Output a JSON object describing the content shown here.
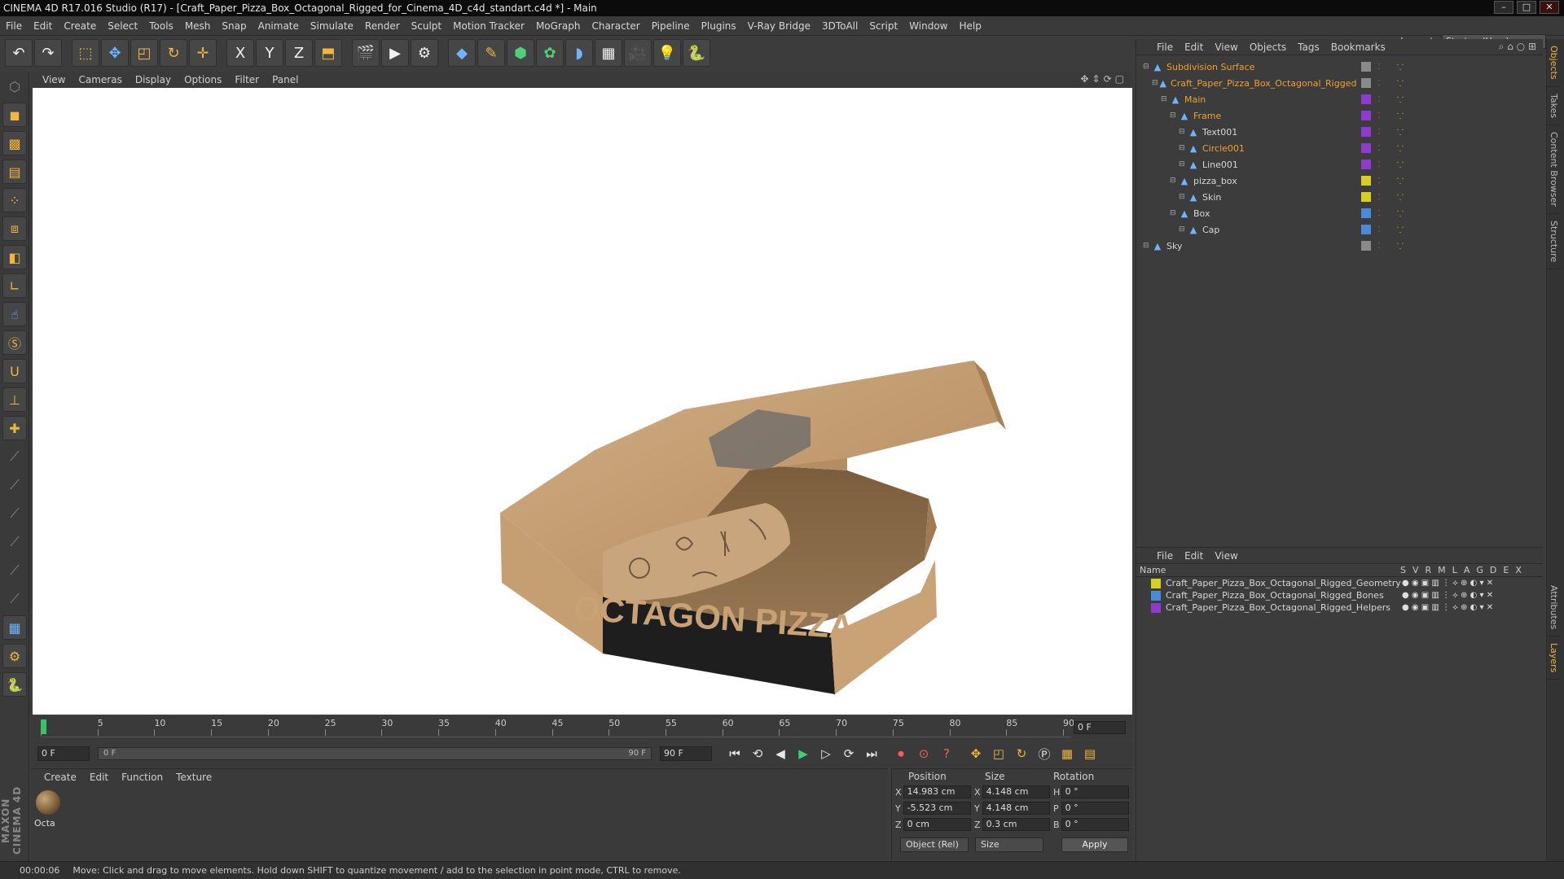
{
  "window": {
    "title": "CINEMA 4D R17.016 Studio (R17) - [Craft_Paper_Pizza_Box_Octagonal_Rigged_for_Cinema_4D_c4d_standart.c4d *] - Main"
  },
  "menubar": {
    "items": [
      "File",
      "Edit",
      "Create",
      "Select",
      "Tools",
      "Mesh",
      "Snap",
      "Animate",
      "Simulate",
      "Render",
      "Sculpt",
      "Motion Tracker",
      "MoGraph",
      "Character",
      "Pipeline",
      "Plugins",
      "V-Ray Bridge",
      "3DToAll",
      "Script",
      "Window",
      "Help"
    ],
    "layout_label": "Layout:",
    "layout_value": "Startup (User)"
  },
  "toolbar": {
    "icons": [
      "undo-icon",
      "redo-icon",
      "live-select-icon",
      "move-icon",
      "scale-icon",
      "rotate-icon",
      "add-icon",
      "x-axis-icon",
      "y-axis-icon",
      "z-axis-icon",
      "coordinate-system-icon",
      "render-view-icon",
      "render-picture-viewer-icon",
      "edit-render-settings-icon",
      "cube-icon",
      "pen-icon",
      "subdivision-icon",
      "array-icon",
      "deformer-icon",
      "floor-icon",
      "camera-icon",
      "light-icon",
      "python-icon"
    ],
    "axis_labels": [
      "X",
      "Y",
      "Z"
    ]
  },
  "viewport": {
    "menu": [
      "View",
      "Cameras",
      "Display",
      "Options",
      "Filter",
      "Panel"
    ],
    "box_label": "OCTAGON PIZZA"
  },
  "timeline": {
    "ticks": [
      "0",
      "5",
      "10",
      "15",
      "20",
      "25",
      "30",
      "35",
      "40",
      "45",
      "50",
      "55",
      "60",
      "65",
      "70",
      "75",
      "80",
      "85",
      "90"
    ],
    "current_frame": "0 F",
    "start_field": "0 F",
    "range_start": "0 F",
    "range_end": "90 F",
    "end_field": "90 F"
  },
  "material_manager": {
    "menu": [
      "Create",
      "Edit",
      "Function",
      "Texture"
    ],
    "material_name": "Octa"
  },
  "coordinates": {
    "headers": [
      "Position",
      "Size",
      "Rotation"
    ],
    "rows": [
      {
        "axis": "X",
        "pos": "14.983 cm",
        "size_axis": "X",
        "size": "4.148 cm",
        "rot_axis": "H",
        "rot": "0 °"
      },
      {
        "axis": "Y",
        "pos": "-5.523 cm",
        "size_axis": "Y",
        "size": "4.148 cm",
        "rot_axis": "P",
        "rot": "0 °"
      },
      {
        "axis": "Z",
        "pos": "0 cm",
        "size_axis": "Z",
        "size": "0.3 cm",
        "rot_axis": "B",
        "rot": "0 °"
      }
    ],
    "mode": "Object (Rel)",
    "size_mode": "Size",
    "apply": "Apply"
  },
  "object_manager": {
    "menu": [
      "File",
      "Edit",
      "View",
      "Objects",
      "Tags",
      "Bookmarks"
    ],
    "objects": [
      {
        "name": "Subdivision Surface",
        "indent": 0,
        "color": "#8a8a8a",
        "highlight": true
      },
      {
        "name": "Craft_Paper_Pizza_Box_Octagonal_Rigged",
        "indent": 1,
        "color": "#8a8a8a",
        "highlight": true
      },
      {
        "name": "Main",
        "indent": 2,
        "color": "#8e3ccf",
        "highlight": true
      },
      {
        "name": "Frame",
        "indent": 3,
        "color": "#8e3ccf",
        "highlight": true
      },
      {
        "name": "Text001",
        "indent": 4,
        "color": "#8e3ccf",
        "highlight": false
      },
      {
        "name": "Circle001",
        "indent": 4,
        "color": "#8e3ccf",
        "highlight": true
      },
      {
        "name": "Line001",
        "indent": 4,
        "color": "#8e3ccf",
        "highlight": false
      },
      {
        "name": "pizza_box",
        "indent": 3,
        "color": "#d8d020",
        "highlight": false
      },
      {
        "name": "Skin",
        "indent": 4,
        "color": "#d8d020",
        "highlight": false
      },
      {
        "name": "Box",
        "indent": 3,
        "color": "#4a8ad8",
        "highlight": false
      },
      {
        "name": "Cap",
        "indent": 4,
        "color": "#4a8ad8",
        "highlight": false
      },
      {
        "name": "Sky",
        "indent": 0,
        "color": "#8a8a8a",
        "highlight": false
      }
    ]
  },
  "layer_manager": {
    "menu": [
      "File",
      "Edit",
      "View"
    ],
    "header_name": "Name",
    "header_flags": [
      "S",
      "V",
      "R",
      "M",
      "L",
      "A",
      "G",
      "D",
      "E",
      "X"
    ],
    "layers": [
      {
        "name": "Craft_Paper_Pizza_Box_Octagonal_Rigged_Geometry",
        "color": "#d8d020"
      },
      {
        "name": "Craft_Paper_Pizza_Box_Octagonal_Rigged_Bones",
        "color": "#4a8ad8"
      },
      {
        "name": "Craft_Paper_Pizza_Box_Octagonal_Rigged_Helpers",
        "color": "#8e3ccf"
      }
    ]
  },
  "side_tabs": [
    "Objects",
    "Takes",
    "Content Browser",
    "Structure",
    "Attributes",
    "Layers"
  ],
  "maxon_logo": "MAXON CINEMA 4D",
  "status": {
    "time": "00:00:06",
    "message": "Move: Click and drag to move elements. Hold down SHIFT to quantize movement / add to the selection in point mode, CTRL to remove."
  }
}
